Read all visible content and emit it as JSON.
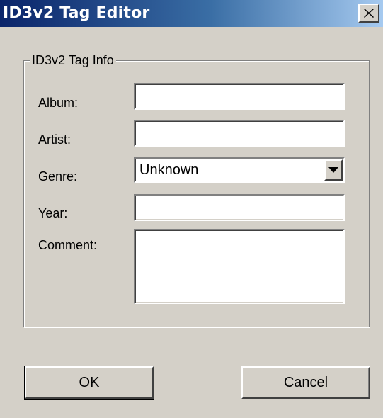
{
  "window": {
    "title": "ID3v2 Tag Editor",
    "close_glyph": "✕"
  },
  "group": {
    "label": "ID3v2 Tag Info"
  },
  "fields": {
    "album": {
      "label": "Album:",
      "value": ""
    },
    "artist": {
      "label": "Artist:",
      "value": ""
    },
    "genre": {
      "label": "Genre:",
      "value": "Unknown"
    },
    "year": {
      "label": "Year:",
      "value": ""
    },
    "comment": {
      "label": "Comment:",
      "value": ""
    }
  },
  "buttons": {
    "ok": "OK",
    "cancel": "Cancel"
  },
  "icons": {
    "close": "close-icon",
    "dropdown": "chevron-down-icon"
  },
  "colors": {
    "titlebar_start": "#0a246a",
    "titlebar_end": "#a6caf0",
    "face": "#d4d0c8"
  }
}
